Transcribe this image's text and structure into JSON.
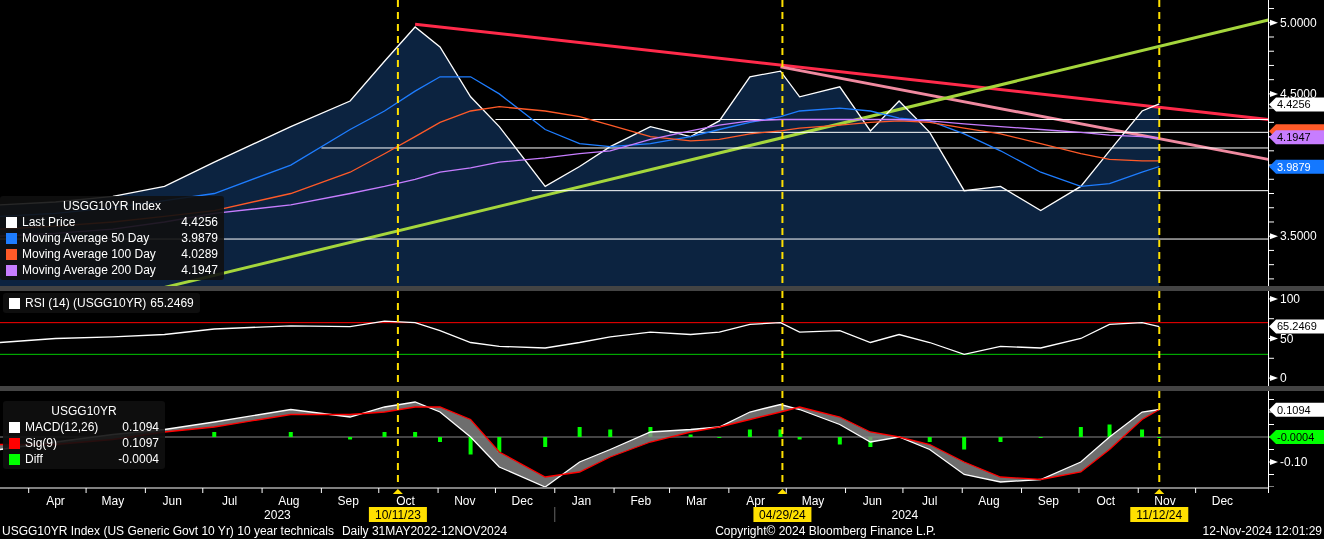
{
  "main": {
    "legend": {
      "title": "USGG10YR Index",
      "items": [
        {
          "label": "Last Price",
          "value": "4.4256",
          "color": "#ffffff"
        },
        {
          "label": "Moving Average 50 Day",
          "value": "3.9879",
          "color": "#1e7dff"
        },
        {
          "label": "Moving Average 100 Day",
          "value": "4.0289",
          "color": "#ff5a28"
        },
        {
          "label": "Moving Average 200 Day",
          "value": "4.1947",
          "color": "#c77dff"
        }
      ]
    },
    "axis_labels": [
      "5.0000",
      "4.5000",
      "3.5000"
    ],
    "tags": [
      {
        "text": "4.4256",
        "color": "#ffffff"
      },
      {
        "color": "#ff5a28"
      },
      {
        "text": "4.1947",
        "color": "#c77dff"
      },
      {
        "text": "3.9879",
        "color": "#1478ff"
      }
    ]
  },
  "rsi": {
    "legend": {
      "items": [
        {
          "label": "RSI (14) (USGG10YR)",
          "value": "65.2469",
          "color": "#ffffff"
        }
      ]
    },
    "axis_labels": [
      "100",
      "50",
      "0"
    ],
    "tags": [
      {
        "text": "65.2469",
        "color": "#ffffff"
      }
    ]
  },
  "macd": {
    "legend": {
      "title": "USGG10YR",
      "items": [
        {
          "label": "MACD(12,26)",
          "value": "0.1094",
          "color": "#ffffff"
        },
        {
          "label": "Sig(9)",
          "value": "0.1097",
          "color": "#ff0000"
        },
        {
          "label": "Diff",
          "value": "-0.0004",
          "color": "#00ff00"
        }
      ]
    },
    "axis_labels": [
      "-0.10"
    ],
    "tags": [
      {
        "text": "0.1094",
        "color": "#ffffff"
      },
      {
        "text": "-0.0004",
        "color": "#00ff00"
      }
    ]
  },
  "x_axis": {
    "months": [
      "Apr",
      "May",
      "Jun",
      "Jul",
      "Aug",
      "Sep",
      "Oct",
      "Nov",
      "Dec",
      "Jan",
      "Feb",
      "Mar",
      "Apr",
      "May",
      "Jun",
      "Jul",
      "Aug",
      "Sep",
      "Oct",
      "Nov",
      "Dec"
    ],
    "years": [
      "2023",
      "2024"
    ],
    "markers": [
      "10/11/23",
      "04/29/24",
      "11/12/24"
    ]
  },
  "footer": {
    "description": "USGG10YR Index (US Generic Govt 10 Yr) 10 year technicals",
    "range": "Daily 31MAY2022-12NOV2024",
    "copyright": "Copyright© 2024 Bloomberg Finance L.P.",
    "timestamp": "12-Nov-2024 12:01:29"
  }
}
